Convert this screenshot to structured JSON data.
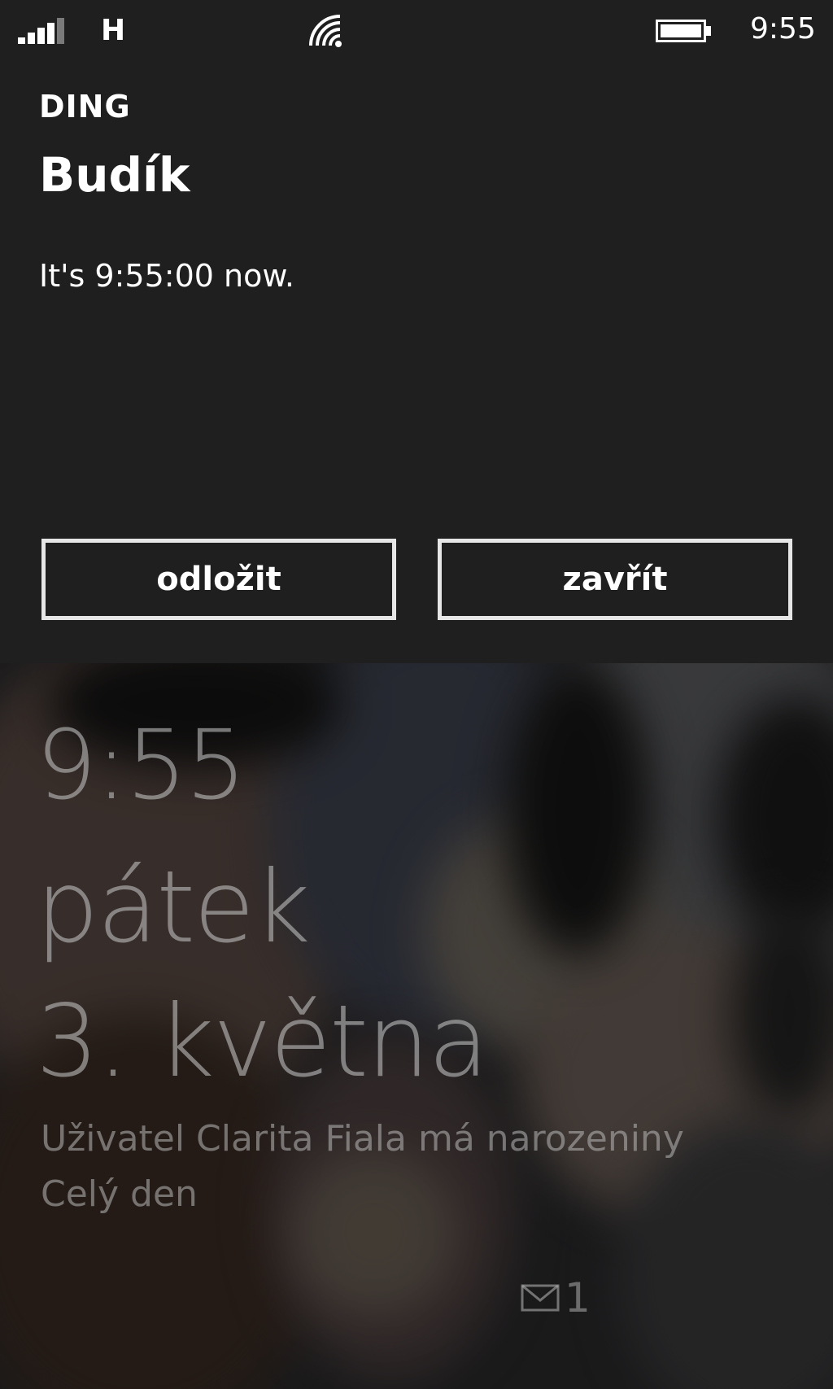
{
  "status_bar": {
    "network_type": "H",
    "time": "9:55",
    "icons": [
      "signal-strength-icon",
      "wifi-icon",
      "battery-icon"
    ]
  },
  "notification": {
    "app_name": "DING",
    "title": "Budík",
    "message": "It's 9:55:00 now.",
    "snooze_label": "odložit",
    "dismiss_label": "zavřít"
  },
  "lock_screen": {
    "time": "9:55",
    "day": "pátek",
    "date": "3. května",
    "event_title": "Uživatel Clarita Fiala má narozeniny",
    "event_detail": "Celý den",
    "mail_icon": "mail-icon",
    "mail_count": "1"
  },
  "colors": {
    "panel_background": "#1f1f1f",
    "text": "#ffffff",
    "button_border": "#e6e6e6",
    "lock_text": "#b9b9b9"
  }
}
